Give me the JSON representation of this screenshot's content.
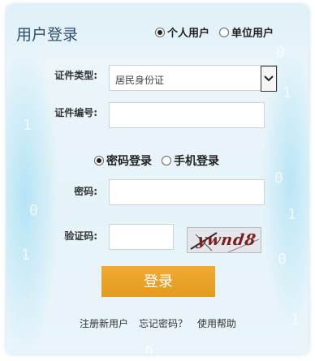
{
  "header": {
    "title": "用户登录",
    "user_types": [
      {
        "label": "个人用户",
        "selected": true
      },
      {
        "label": "单位用户",
        "selected": false
      }
    ]
  },
  "form": {
    "cert_type_label": "证件类型:",
    "cert_type_value": "居民身份证",
    "cert_number_label": "证件编号:",
    "login_modes": [
      {
        "label": "密码登录",
        "selected": true
      },
      {
        "label": "手机登录",
        "selected": false
      }
    ],
    "password_label": "密码:",
    "captcha_label": "验证码:",
    "captcha_text": "ywnd8",
    "login_button": "登录"
  },
  "links": {
    "register": "注册新用户",
    "forgot_password": "忘记密码？",
    "help": "使用帮助"
  },
  "decor": [
    "0",
    "1",
    "0",
    "1",
    "0",
    "1",
    "0",
    "1",
    "0",
    "1"
  ],
  "colors": {
    "accent": "#e39a1d",
    "title": "#2f4f6a"
  }
}
